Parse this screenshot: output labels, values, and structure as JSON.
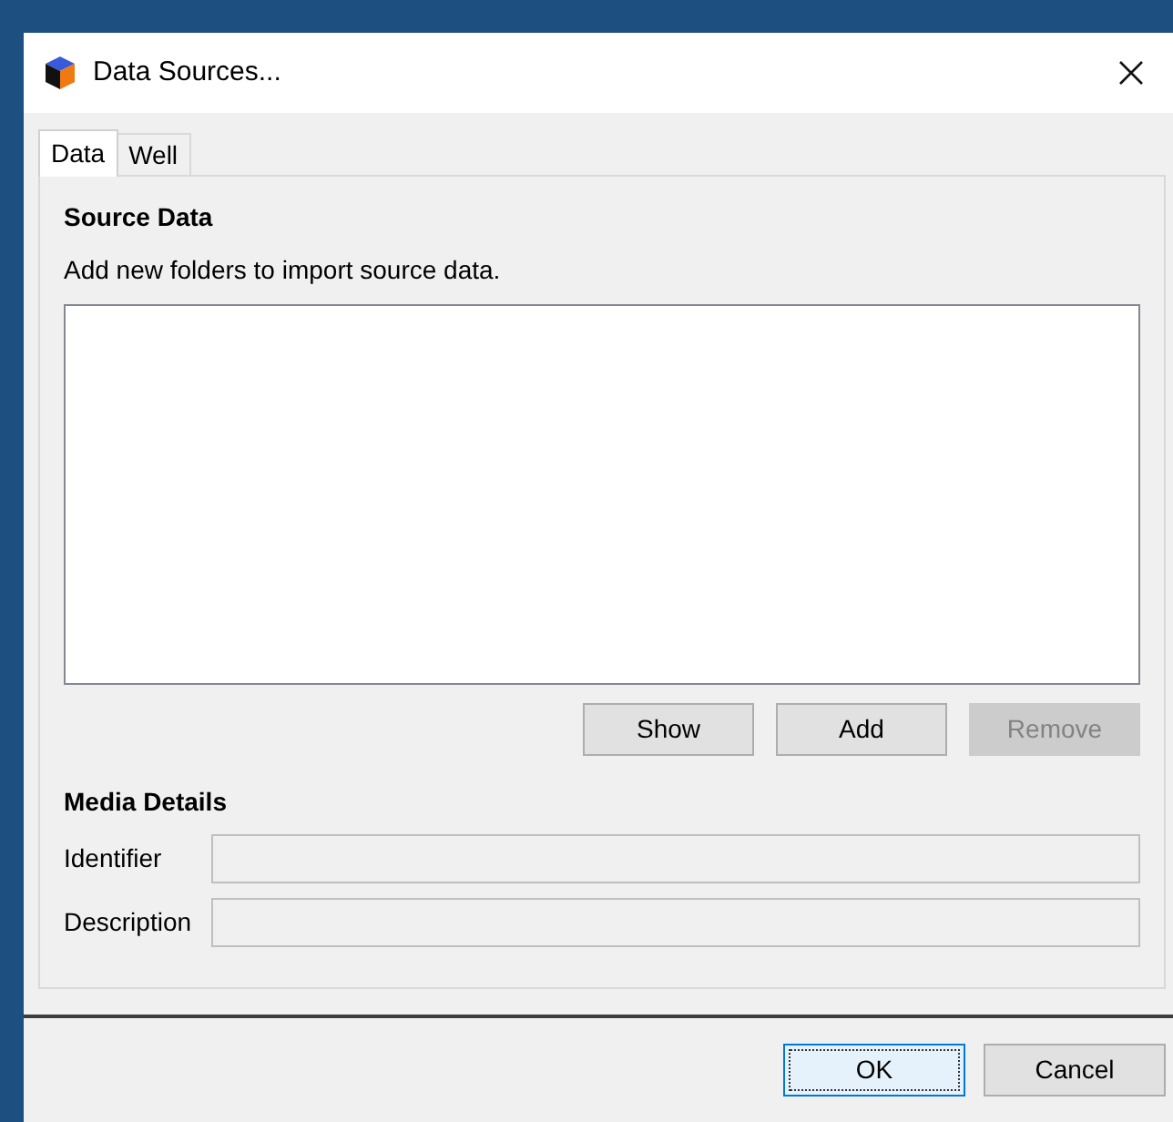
{
  "window": {
    "title": "Data Sources..."
  },
  "tabs": [
    {
      "label": "Data",
      "selected": true
    },
    {
      "label": "Well",
      "selected": false
    }
  ],
  "source_data": {
    "heading": "Source Data",
    "hint": "Add new folders to import source data.",
    "buttons": [
      {
        "label": "Show",
        "disabled": false
      },
      {
        "label": "Add",
        "disabled": false
      },
      {
        "label": "Remove",
        "disabled": true
      }
    ]
  },
  "media_details": {
    "heading": "Media Details",
    "fields": [
      {
        "label": "Identifier",
        "disabled": true
      },
      {
        "label": "Description",
        "disabled": true
      }
    ]
  },
  "buttons": [
    {
      "label": "OK",
      "selected": true
    },
    {
      "label": "Cancel",
      "selected": false
    }
  ]
}
